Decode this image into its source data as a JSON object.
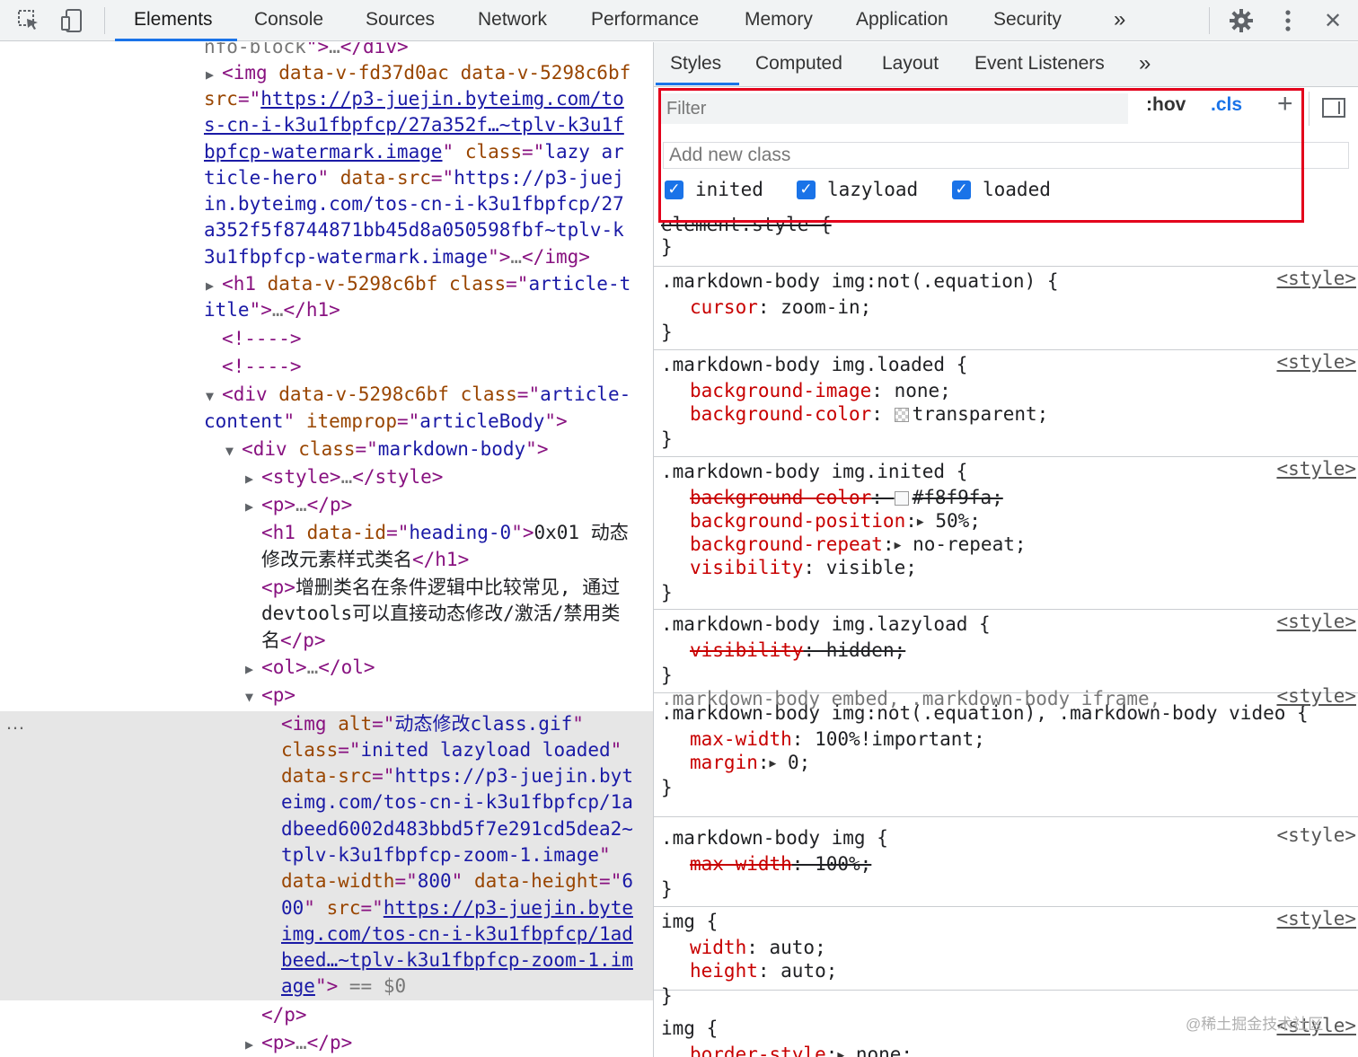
{
  "toolbar": {
    "inspect_icon": "inspect-cursor-icon",
    "device_icon": "device-toggle-icon",
    "tabs": [
      "Elements",
      "Console",
      "Sources",
      "Network",
      "Performance",
      "Memory",
      "Application",
      "Security"
    ],
    "more": "»",
    "settings_icon": "gear-icon",
    "menu_icon": "kebab-menu-icon",
    "close": "✕"
  },
  "elements": {
    "lines": [
      {
        "parts": [
          [
            "gray",
            "nfo-block"
          ],
          [
            "tag",
            "\">"
          ],
          [
            "gray",
            "…"
          ],
          [
            "tag",
            "</div>"
          ]
        ]
      },
      {
        "parts": [
          [
            "tri",
            "▶ "
          ],
          [
            "tag",
            "<img "
          ],
          [
            "an",
            "data-v-fd37d0ac "
          ],
          [
            "an",
            "data-v-5298c6bf"
          ]
        ]
      },
      {
        "parts": [
          [
            "an",
            "src"
          ],
          [
            "tag",
            "=\""
          ],
          [
            "lnk",
            "https://p3-juejin.byteimg.com/to"
          ]
        ]
      },
      {
        "parts": [
          [
            "lnk",
            "s-cn-i-k3u1fbpfcp/27a352f…~tplv-k3u1f"
          ]
        ]
      },
      {
        "parts": [
          [
            "lnk",
            "bpfcp-watermark.image"
          ],
          [
            "tag",
            "\" "
          ],
          [
            "an",
            "class"
          ],
          [
            "tag",
            "=\""
          ],
          [
            "av",
            "lazy ar"
          ]
        ]
      },
      {
        "parts": [
          [
            "av",
            "ticle-hero"
          ],
          [
            "tag",
            "\" "
          ],
          [
            "an",
            "data-src"
          ],
          [
            "tag",
            "=\""
          ],
          [
            "av",
            "https://p3-juej"
          ]
        ]
      },
      {
        "parts": [
          [
            "av",
            "in.byteimg.com/tos-cn-i-k3u1fbpfcp/27"
          ]
        ]
      },
      {
        "parts": [
          [
            "av",
            "a352f5f8744871bb45d8a050598fbf~tplv-k"
          ]
        ]
      },
      {
        "parts": [
          [
            "av",
            "3u1fbpfcp-watermark.image"
          ],
          [
            "tag",
            "\">"
          ],
          [
            "gray",
            "…"
          ],
          [
            "tag",
            "</img>"
          ]
        ]
      },
      {
        "parts": [
          [
            "tri",
            "▶ "
          ],
          [
            "tag",
            "<h1 "
          ],
          [
            "an",
            "data-v-5298c6bf "
          ],
          [
            "an",
            "class"
          ],
          [
            "tag",
            "=\""
          ],
          [
            "av",
            "article-t"
          ]
        ]
      },
      {
        "parts": [
          [
            "av",
            "itle"
          ],
          [
            "tag",
            "\">"
          ],
          [
            "gray",
            "…"
          ],
          [
            "tag",
            "</h1>"
          ]
        ]
      },
      {
        "parts": [
          [
            "tag",
            "<!---->"
          ]
        ]
      },
      {
        "parts": [
          [
            "tag",
            "<!---->"
          ]
        ]
      },
      {
        "parts": [
          [
            "tri",
            "▼ "
          ],
          [
            "tag",
            "<div "
          ],
          [
            "an",
            "data-v-5298c6bf "
          ],
          [
            "an",
            "class"
          ],
          [
            "tag",
            "=\""
          ],
          [
            "av",
            "article-"
          ]
        ]
      },
      {
        "parts": [
          [
            "av",
            "content"
          ],
          [
            "tag",
            "\" "
          ],
          [
            "an",
            "itemprop"
          ],
          [
            "tag",
            "=\""
          ],
          [
            "av",
            "articleBody"
          ],
          [
            "tag",
            "\">"
          ]
        ]
      },
      {
        "parts": [
          [
            "tri",
            "▼ "
          ],
          [
            "tag",
            "<div "
          ],
          [
            "an",
            "class"
          ],
          [
            "tag",
            "=\""
          ],
          [
            "av",
            "markdown-body"
          ],
          [
            "tag",
            "\">"
          ]
        ]
      },
      {
        "parts": [
          [
            "tri",
            "▶ "
          ],
          [
            "tag",
            "<style>"
          ],
          [
            "gray",
            "…"
          ],
          [
            "tag",
            "</style>"
          ]
        ]
      },
      {
        "parts": [
          [
            "tri",
            "▶ "
          ],
          [
            "tag",
            "<p>"
          ],
          [
            "gray",
            "…"
          ],
          [
            "tag",
            "</p>"
          ]
        ]
      },
      {
        "parts": [
          [
            "tag",
            "<h1 "
          ],
          [
            "an",
            "data-id"
          ],
          [
            "tag",
            "=\""
          ],
          [
            "av",
            "heading-0"
          ],
          [
            "tag",
            "\">"
          ],
          [
            "txt",
            "0x01 动态"
          ]
        ]
      },
      {
        "parts": [
          [
            "txt",
            "修改元素样式类名"
          ],
          [
            "tag",
            "</h1>"
          ]
        ]
      },
      {
        "parts": [
          [
            "tag",
            "<p>"
          ],
          [
            "txt",
            "增删类名在条件逻辑中比较常见, 通过"
          ]
        ]
      },
      {
        "parts": [
          [
            "txt",
            "devtools可以直接动态修改/激活/禁用类"
          ]
        ]
      },
      {
        "parts": [
          [
            "txt",
            "名"
          ],
          [
            "tag",
            "</p>"
          ]
        ]
      },
      {
        "parts": [
          [
            "tri",
            "▶ "
          ],
          [
            "tag",
            "<ol>"
          ],
          [
            "gray",
            "…"
          ],
          [
            "tag",
            "</ol>"
          ]
        ]
      },
      {
        "parts": [
          [
            "tri",
            "▼ "
          ],
          [
            "tag",
            "<p>"
          ]
        ]
      },
      {
        "parts": [
          [
            "tag",
            "<img "
          ],
          [
            "an",
            "alt"
          ],
          [
            "tag",
            "=\""
          ],
          [
            "av",
            "动态修改class.gif"
          ],
          [
            "tag",
            "\""
          ]
        ]
      },
      {
        "parts": [
          [
            "an",
            "class"
          ],
          [
            "tag",
            "=\""
          ],
          [
            "av",
            "inited lazyload loaded"
          ],
          [
            "tag",
            "\""
          ]
        ]
      },
      {
        "parts": [
          [
            "an",
            "data-src"
          ],
          [
            "tag",
            "=\""
          ],
          [
            "av",
            "https://p3-juejin.byt"
          ]
        ]
      },
      {
        "parts": [
          [
            "av",
            "eimg.com/tos-cn-i-k3u1fbpfcp/1a"
          ]
        ]
      },
      {
        "parts": [
          [
            "av",
            "dbeed6002d483bbd5f7e291cd5dea2~"
          ]
        ]
      },
      {
        "parts": [
          [
            "av",
            "tplv-k3u1fbpfcp-zoom-1.image"
          ],
          [
            "tag",
            "\""
          ]
        ]
      },
      {
        "parts": [
          [
            "an",
            "data-width"
          ],
          [
            "tag",
            "=\""
          ],
          [
            "av",
            "800"
          ],
          [
            "tag",
            "\" "
          ],
          [
            "an",
            "data-height"
          ],
          [
            "tag",
            "=\""
          ],
          [
            "av",
            "6"
          ]
        ]
      },
      {
        "parts": [
          [
            "av",
            "00"
          ],
          [
            "tag",
            "\" "
          ],
          [
            "an",
            "src"
          ],
          [
            "tag",
            "=\""
          ],
          [
            "lnk",
            "https://p3-juejin.byte"
          ]
        ]
      },
      {
        "parts": [
          [
            "lnk",
            "img.com/tos-cn-i-k3u1fbpfcp/1ad"
          ]
        ]
      },
      {
        "parts": [
          [
            "lnk",
            "beed…~tplv-k3u1fbpfcp-zoom-1.im"
          ]
        ]
      },
      {
        "parts": [
          [
            "lnk",
            "age"
          ],
          [
            "tag",
            "\">"
          ],
          [
            "gray",
            " == "
          ],
          [
            "gray",
            "$0"
          ]
        ]
      },
      {
        "parts": [
          [
            "tag",
            "</p>"
          ]
        ]
      },
      {
        "parts": [
          [
            "tri",
            "▶ "
          ],
          [
            "tag",
            "<p>"
          ],
          [
            "gray",
            "…"
          ],
          [
            "tag",
            "</p>"
          ]
        ]
      }
    ],
    "selected_dots": "…"
  },
  "styles": {
    "subtabs": [
      "Styles",
      "Computed",
      "Layout",
      "Event Listeners"
    ],
    "subtabs_more": "»",
    "filter_placeholder": "Filter",
    "hov": ":hov",
    "cls": ".cls",
    "plus": "+",
    "add_class_placeholder": "Add new class",
    "classes": [
      {
        "name": "inited",
        "checked": true
      },
      {
        "name": "lazyload",
        "checked": true
      },
      {
        "name": "loaded",
        "checked": true
      }
    ],
    "rules": [
      {
        "lines": [
          [
            [
              "strike",
              "element.style {"
            ]
          ]
        ],
        "close": "}"
      },
      {
        "selector": ".markdown-body img:not(.equation) {",
        "source": "<style>",
        "decls": [
          [
            [
              "prop",
              "cursor"
            ],
            [
              "txt",
              ": zoom-in;"
            ]
          ]
        ]
      },
      {
        "selector": ".markdown-body img.loaded {",
        "source": "<style>",
        "decls": [
          [
            [
              "prop",
              "background-image"
            ],
            [
              "txt",
              ": none;"
            ]
          ],
          [
            [
              "prop",
              "background-color"
            ],
            [
              "txt",
              ": "
            ],
            [
              "swatch",
              "transparent"
            ],
            [
              "txt",
              "transparent;"
            ]
          ]
        ]
      },
      {
        "selector": ".markdown-body img.inited {",
        "source": "<style>",
        "decls": [
          [
            [
              "pstrike",
              "background-color"
            ],
            [
              "strike",
              ": "
            ],
            [
              "swatchf8",
              "#f8f9fa"
            ],
            [
              "strike",
              "#f8f9fa;"
            ]
          ],
          [
            [
              "prop",
              "background-position"
            ],
            [
              "txt",
              ":"
            ],
            [
              "arrow",
              "▶"
            ],
            [
              "txt",
              " 50%;"
            ]
          ],
          [
            [
              "prop",
              "background-repeat"
            ],
            [
              "txt",
              ":"
            ],
            [
              "arrow",
              "▶"
            ],
            [
              "txt",
              " no-repeat;"
            ]
          ],
          [
            [
              "prop",
              "visibility"
            ],
            [
              "txt",
              ": visible;"
            ]
          ]
        ]
      },
      {
        "selector": ".markdown-body img.lazyload {",
        "source": "<style>",
        "decls": [
          [
            [
              "pstrike",
              "visibility"
            ],
            [
              "strike",
              ": hidden;"
            ]
          ]
        ]
      },
      {
        "selector_gray": ".markdown-body embed, .markdown-body iframe,",
        "selector2": ".markdown-body img:not(.equation), .markdown-body video {",
        "source": "<style>",
        "decls": [
          [
            [
              "prop",
              "max-width"
            ],
            [
              "txt",
              ": 100%!important;"
            ]
          ],
          [
            [
              "prop",
              "margin"
            ],
            [
              "txt",
              ":"
            ],
            [
              "arrow",
              "▶"
            ],
            [
              "txt",
              " 0;"
            ]
          ]
        ]
      },
      {
        "selector": ".markdown-body img {",
        "source": "<style>",
        "decls": [
          [
            [
              "pstrike",
              "max-width"
            ],
            [
              "strike",
              ": 100%;"
            ]
          ]
        ]
      },
      {
        "selector": "img {",
        "source": "<style>",
        "decls": [
          [
            [
              "prop",
              "width"
            ],
            [
              "txt",
              ": auto;"
            ]
          ],
          [
            [
              "prop",
              "height"
            ],
            [
              "txt",
              ": auto;"
            ]
          ]
        ]
      },
      {
        "selector": "img {",
        "source": "<style>",
        "decls": [
          [
            [
              "prop",
              "border-style"
            ],
            [
              "txt",
              ":"
            ],
            [
              "arrow",
              "▶"
            ],
            [
              "txt",
              " none;"
            ]
          ]
        ]
      }
    ]
  },
  "watermark": "@稀土掘金技术社区"
}
